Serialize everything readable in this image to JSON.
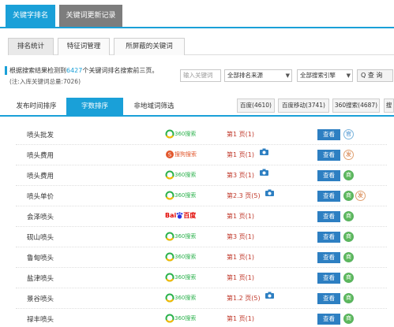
{
  "top_tabs": [
    "关键字排名",
    "关键词更新记录"
  ],
  "sub_tabs": [
    "排名统计",
    "特征词管理",
    "所屏蔽的关键词"
  ],
  "info": {
    "prefix": "根据搜索结果检测到",
    "count": "6427",
    "suffix": "个关键词排名搜索前三页。",
    "note": "(注:入库关键词总量:7026)"
  },
  "search": {
    "placeholder": "输入关键词"
  },
  "filters": {
    "source": "全部排名来源",
    "engine": "全部搜索引擎"
  },
  "query_button": "Q 查 询",
  "mode_tabs": [
    "发布时间排序",
    "字数排序",
    "非地域词筛选"
  ],
  "engine_buttons": [
    "百度(4610)",
    "百度移动(3741)",
    "360搜索(4687)",
    "搜"
  ],
  "rows": [
    {
      "keyword": "喷头批发",
      "engine": "360搜索",
      "rank": "第1 页(1)",
      "camera": false,
      "view": "查看",
      "badges": [
        {
          "t": "官",
          "c": "blue"
        }
      ]
    },
    {
      "keyword": "喷头费用",
      "engine": "搜狗搜索",
      "rank": "第1 页(1)",
      "camera": true,
      "view": "查看",
      "badges": [
        {
          "t": "发",
          "c": "orange"
        }
      ]
    },
    {
      "keyword": "喷头费用",
      "engine": "360搜索",
      "rank": "第3 页(1)",
      "camera": true,
      "view": "查看",
      "badges": [
        {
          "t": "商",
          "c": "green"
        }
      ]
    },
    {
      "keyword": "喷头单价",
      "engine": "360搜索",
      "rank": "第2.3 页(5)",
      "camera": true,
      "view": "查看",
      "badges": [
        {
          "t": "商",
          "c": "green"
        },
        {
          "t": "发",
          "c": "orange"
        }
      ]
    },
    {
      "keyword": "会泽喷头",
      "engine": "百度",
      "rank": "第1 页(1)",
      "camera": false,
      "view": "查看",
      "badges": [
        {
          "t": "商",
          "c": "green"
        }
      ]
    },
    {
      "keyword": "砚山喷头",
      "engine": "360搜索",
      "rank": "第3 页(1)",
      "camera": false,
      "view": "查看",
      "badges": [
        {
          "t": "商",
          "c": "green"
        }
      ]
    },
    {
      "keyword": "鲁甸喷头",
      "engine": "360搜索",
      "rank": "第1 页(1)",
      "camera": false,
      "view": "查看",
      "badges": [
        {
          "t": "商",
          "c": "green"
        }
      ]
    },
    {
      "keyword": "盐津喷头",
      "engine": "360搜索",
      "rank": "第1 页(1)",
      "camera": false,
      "view": "查看",
      "badges": [
        {
          "t": "商",
          "c": "green"
        }
      ]
    },
    {
      "keyword": "景谷喷头",
      "engine": "360搜索",
      "rank": "第1.2 页(5)",
      "camera": true,
      "view": "查看",
      "badges": [
        {
          "t": "商",
          "c": "green"
        }
      ]
    },
    {
      "keyword": "禄丰喷头",
      "engine": "360搜索",
      "rank": "第1 页(1)",
      "camera": false,
      "view": "查看",
      "badges": [
        {
          "t": "商",
          "c": "green"
        }
      ]
    }
  ]
}
